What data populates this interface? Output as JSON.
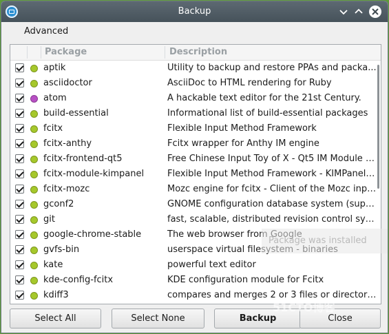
{
  "window": {
    "title": "Backup"
  },
  "menu": {
    "advanced": "Advanced"
  },
  "columns": {
    "package": "Package",
    "description": "Description"
  },
  "packages": [
    {
      "name": "aptik",
      "description": "Utility to backup and restore PPAs and packa...",
      "status_color": "#a6c82b"
    },
    {
      "name": "asciidoctor",
      "description": "AsciiDoc to HTML rendering for Ruby",
      "status_color": "#a6c82b"
    },
    {
      "name": "atom",
      "description": "A hackable text editor for the 21st Century.",
      "status_color": "#b84fc4"
    },
    {
      "name": "build-essential",
      "description": "Informational list of build-essential packages",
      "status_color": "#a6c82b"
    },
    {
      "name": "fcitx",
      "description": "Flexible Input Method Framework",
      "status_color": "#a6c82b"
    },
    {
      "name": "fcitx-anthy",
      "description": "Fcitx wrapper for Anthy IM engine",
      "status_color": "#a6c82b"
    },
    {
      "name": "fcitx-frontend-qt5",
      "description": "Free Chinese Input Toy of X - Qt5 IM Module fr...",
      "status_color": "#a6c82b"
    },
    {
      "name": "fcitx-module-kimpanel",
      "description": "Flexible Input Method Framework - KIMPanel p...",
      "status_color": "#a6c82b"
    },
    {
      "name": "fcitx-mozc",
      "description": "Mozc engine for fcitx - Client of the Mozc inpu...",
      "status_color": "#a6c82b"
    },
    {
      "name": "gconf2",
      "description": "GNOME configuration database system (supp...",
      "status_color": "#a6c82b"
    },
    {
      "name": "git",
      "description": "fast, scalable, distributed revision control syst...",
      "status_color": "#a6c82b"
    },
    {
      "name": "google-chrome-stable",
      "description": "The web browser from Google",
      "status_color": "#a6c82b"
    },
    {
      "name": "gvfs-bin",
      "description": "userspace virtual filesystem - binaries",
      "status_color": "#a6c82b"
    },
    {
      "name": "kate",
      "description": "powerful text editor",
      "status_color": "#a6c82b"
    },
    {
      "name": "kde-config-fcitx",
      "description": "KDE configuration module for Fcitx",
      "status_color": "#a6c82b"
    },
    {
      "name": "kdiff3",
      "description": "compares and merges 2 or 3 files or directories",
      "status_color": "#a6c82b"
    }
  ],
  "tooltip": {
    "text": "Package was installed"
  },
  "buttons": {
    "select_all": "Select All",
    "select_none": "Select None",
    "backup": "Backup",
    "close": "Close"
  },
  "watermark": "51CTO博客",
  "colors": {
    "titlebar": "#4f5b63",
    "installed_dot": "#a6c82b",
    "extra_dot": "#b84fc4"
  }
}
